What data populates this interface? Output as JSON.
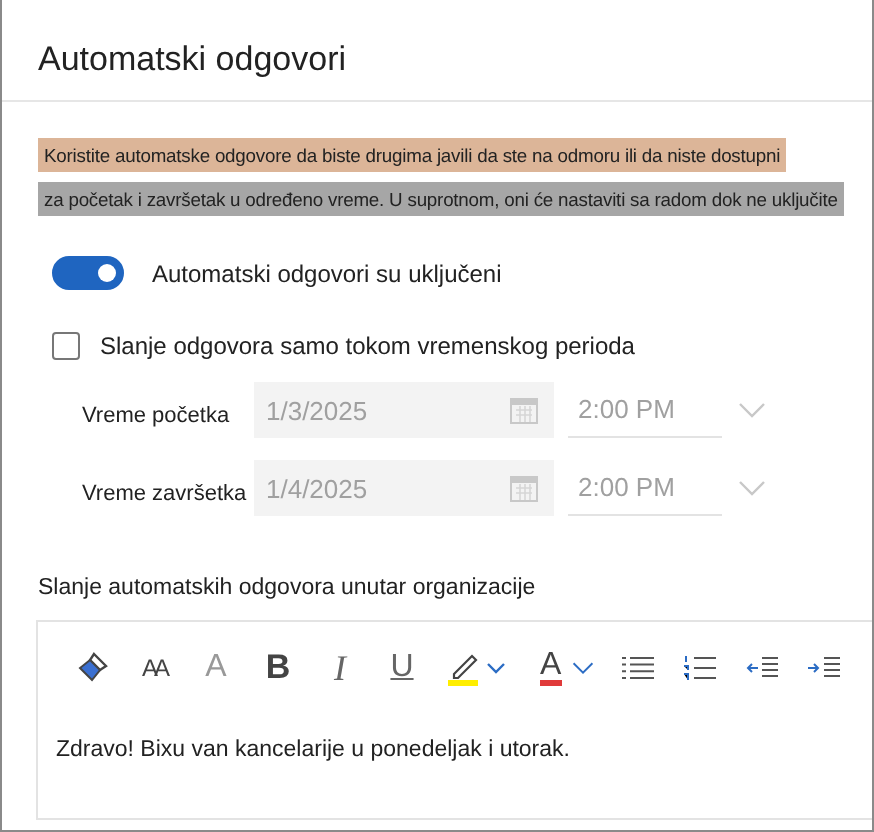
{
  "window": {
    "title": "Automatski odgovori"
  },
  "description": [
    {
      "text": "Koristite automatske odgovore da biste drugima javili da ste na odmoru ili da niste dostupni",
      "color": "#dcb598"
    },
    {
      "text": "za početak i završetak u određeno vreme. U suprotnom, oni će nastaviti sa radom dok ne uključite",
      "color": "#a6a6a6"
    }
  ],
  "toggle": {
    "label": "Automatski odgovori su uključeni",
    "on": true
  },
  "period": {
    "label": "Slanje odgovora samo tokom vremenskog perioda",
    "checked": false,
    "rows": [
      {
        "label": "Vreme početka",
        "date": "1/3/2025",
        "time": "2:00 PM",
        "disabled": true
      },
      {
        "label": "Vreme završetka",
        "date": "1/4/2025",
        "time": "2:00 PM",
        "disabled": true
      }
    ]
  },
  "internal": {
    "label": "Slanje automatskih odgovora unutar organizacije",
    "toolbar": [
      {
        "kind": "painter"
      },
      {
        "kind": "font-size",
        "label": "AA"
      },
      {
        "kind": "grow",
        "label": "A"
      },
      {
        "kind": "bold",
        "label": "B"
      },
      {
        "kind": "italic",
        "label": "I"
      },
      {
        "kind": "underline",
        "label": "U"
      },
      {
        "kind": "highlight"
      },
      {
        "kind": "font-color",
        "label": "A"
      },
      {
        "kind": "bullets"
      },
      {
        "kind": "numbering"
      },
      {
        "kind": "outdent"
      },
      {
        "kind": "indent"
      }
    ],
    "message": "Zdravo! Bixu van kancelarije u ponedeljak i utorak."
  }
}
